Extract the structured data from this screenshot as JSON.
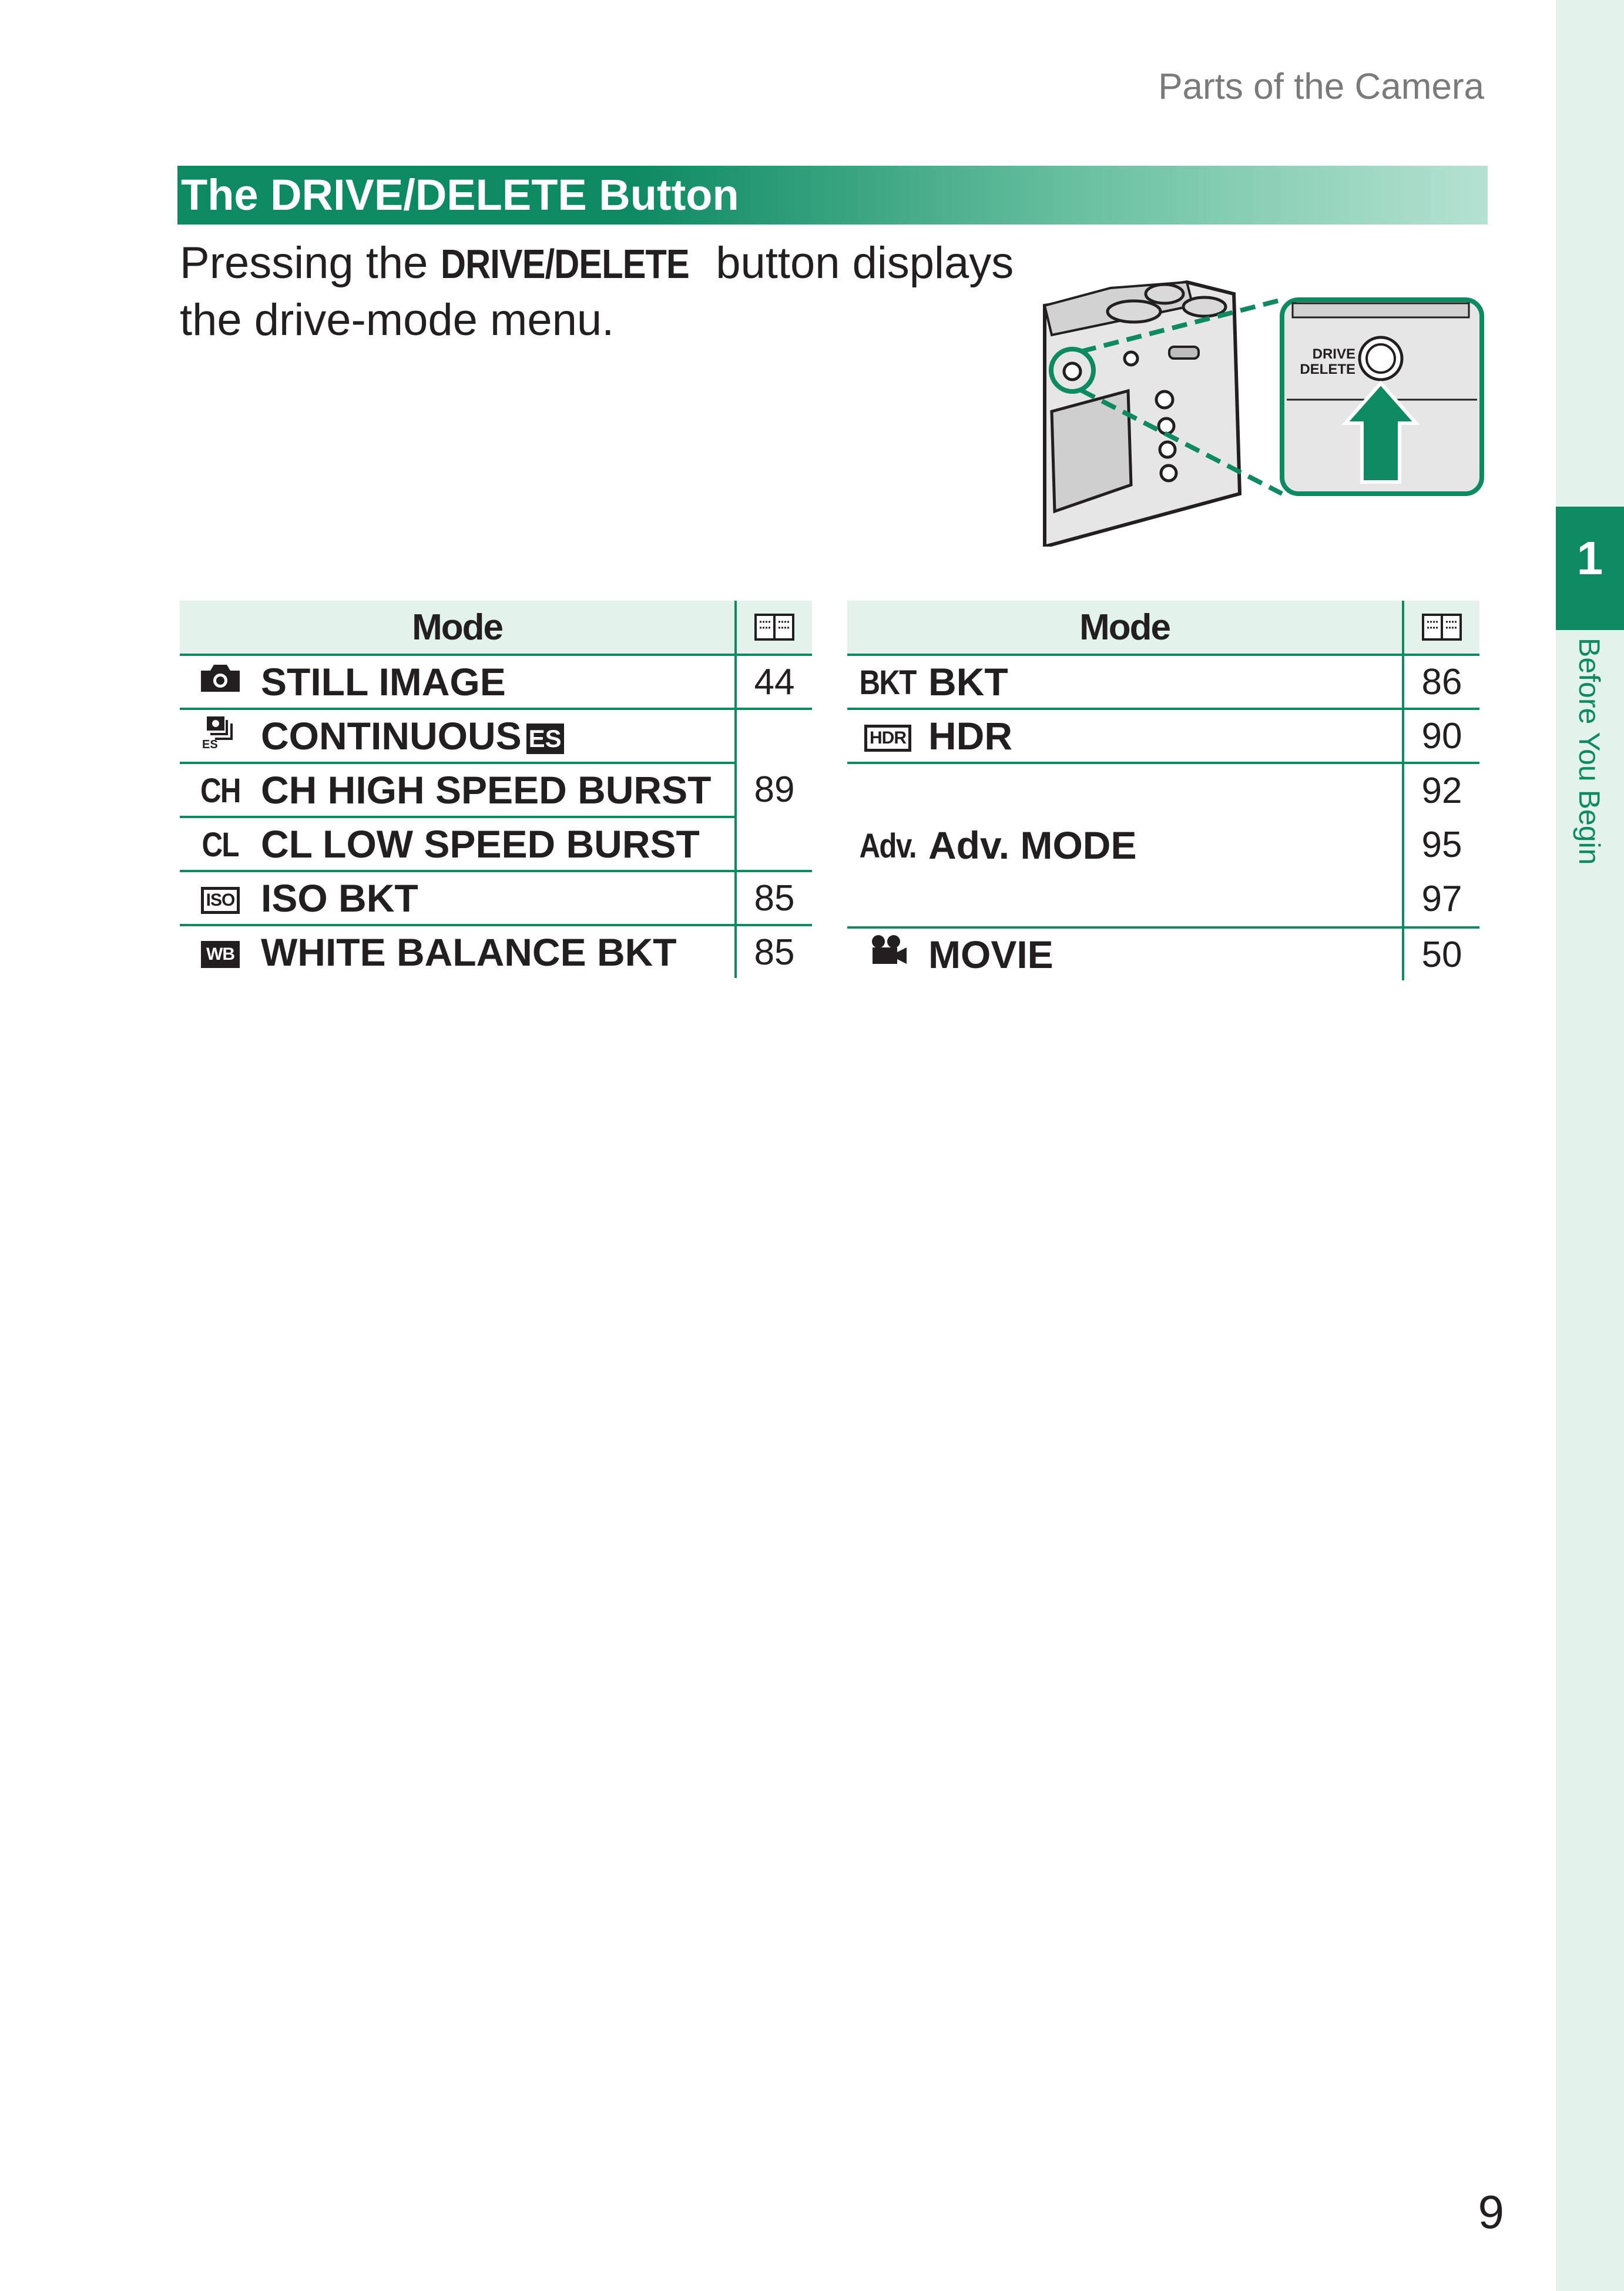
{
  "header": {
    "section": "Parts of the Camera"
  },
  "sidebar": {
    "chapter_number": "1",
    "chapter_title": "Before You Begin"
  },
  "section": {
    "title": "The DRIVE/DELETE Button",
    "intro_before": "Pressing the ",
    "intro_button": "DRIVE/DELETE",
    "intro_after": " button displays the drive-mode menu."
  },
  "illustration": {
    "button_label_line1": "DRIVE",
    "button_label_line2": "DELETE"
  },
  "table_left": {
    "header_mode": "Mode",
    "header_page_icon": "book-icon",
    "rows": [
      {
        "icon": "camera-icon",
        "icon_text": "",
        "name": "STILL IMAGE",
        "page": "44"
      },
      {
        "icon": "continuous-es-icon",
        "icon_text": "ES",
        "name": "CONTINUOUS",
        "name_suffix": "ES",
        "page": ""
      },
      {
        "icon": "ch-icon",
        "icon_text": "CH",
        "name": "CH HIGH SPEED BURST",
        "page": "89"
      },
      {
        "icon": "cl-icon",
        "icon_text": "CL",
        "name": "CL LOW SPEED BURST",
        "page": ""
      },
      {
        "icon": "iso-bkt-icon",
        "icon_text": "ISO",
        "name": "ISO BKT",
        "page": "85"
      },
      {
        "icon": "wb-bkt-icon",
        "icon_text": "WB",
        "name": "WHITE BALANCE BKT",
        "page": "85"
      }
    ]
  },
  "table_right": {
    "header_mode": "Mode",
    "header_page_icon": "book-icon",
    "rows": [
      {
        "icon": "bkt-icon",
        "icon_text": "BKT",
        "name": "BKT",
        "page": "86"
      },
      {
        "icon": "hdr-icon",
        "icon_text": "HDR",
        "name": "HDR",
        "page": "90"
      },
      {
        "icon": "adv-icon",
        "icon_text": "Adv.",
        "name": "Adv. MODE",
        "pages": [
          "92",
          "95",
          "97"
        ]
      },
      {
        "icon": "movie-icon",
        "icon_text": "",
        "name": "MOVIE",
        "page": "50"
      }
    ]
  },
  "footer": {
    "page_number": "9"
  },
  "colors": {
    "accent": "#0e8a63",
    "tint": "#e3f3ec",
    "text": "#231f20"
  }
}
